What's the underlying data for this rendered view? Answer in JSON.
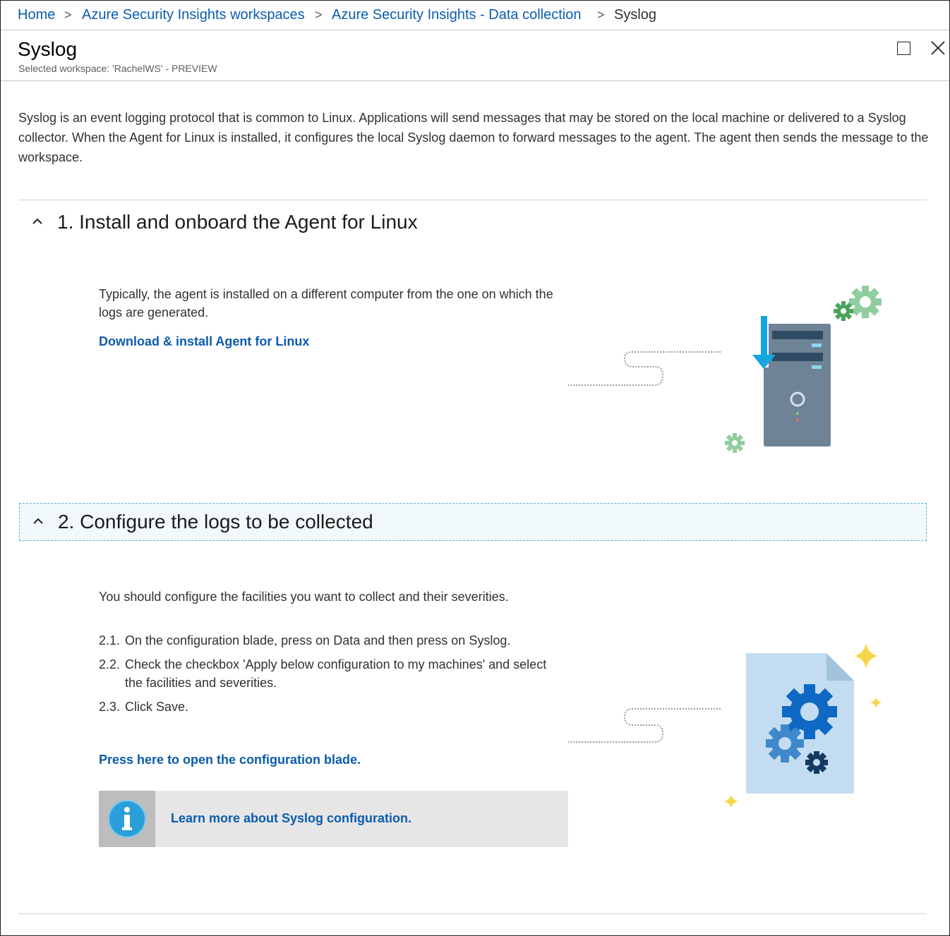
{
  "breadcrumb": {
    "items": [
      {
        "label": "Home"
      },
      {
        "label": "Azure Security Insights workspaces"
      },
      {
        "label": "Azure Security Insights - Data collection"
      }
    ],
    "current": "Syslog",
    "separator": ">"
  },
  "blade": {
    "title": "Syslog",
    "subtitle": "Selected workspace: 'RachelWS' - PREVIEW"
  },
  "intro": "Syslog is an event logging protocol that is common to Linux. Applications will send messages that may be stored on the local machine or delivered to a Syslog collector. When the Agent for Linux is installed, it configures the local Syslog daemon to forward messages to the agent. The agent then sends the message to the workspace.",
  "section1": {
    "title": "1. Install and onboard the Agent for Linux",
    "text": "Typically, the agent is installed on a different computer from the one on which the logs are generated.",
    "link": "Download & install Agent for Linux"
  },
  "section2": {
    "title": "2. Configure the logs to be collected",
    "text": "You should configure the facilities you want to collect and their severities.",
    "steps": [
      {
        "num": "2.1.",
        "text": "On the configuration blade, press on Data and then press on Syslog."
      },
      {
        "num": "2.2.",
        "text": "Check the checkbox 'Apply below configuration to my machines' and select the facilities and severities."
      },
      {
        "num": "2.3.",
        "text": "Click Save."
      }
    ],
    "link": "Press here to open the configuration blade.",
    "info_link": "Learn more about Syslog configuration."
  },
  "icons": {
    "maximize": "maximize-icon",
    "close": "close-icon",
    "chevron": "chevron-up-icon",
    "info": "info-icon",
    "server": "server-illustration",
    "config_doc": "config-document-illustration"
  },
  "colors": {
    "link": "#0b5cad",
    "focus_bg": "#f1f9fc",
    "focus_border": "#5ab4d8"
  }
}
